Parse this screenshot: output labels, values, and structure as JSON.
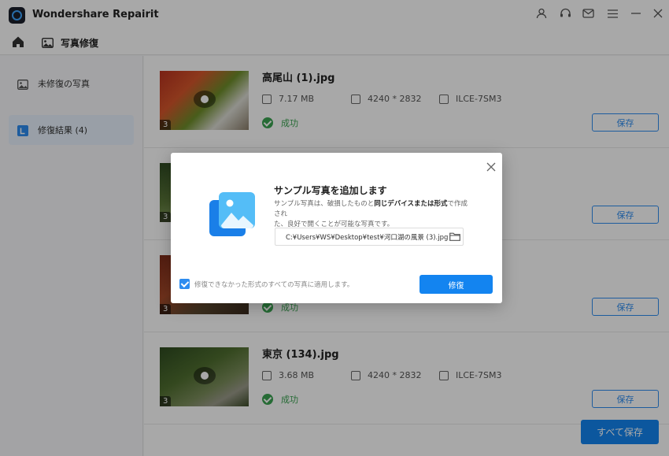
{
  "app": {
    "title": "Wondershare Repairit"
  },
  "navbar": {
    "title": "写真修復"
  },
  "sidebar": {
    "items": [
      {
        "label": "未修復の写真"
      },
      {
        "label": "修復結果 (4)"
      }
    ]
  },
  "cards": [
    {
      "filename": "高尾山 (1).jpg",
      "size": "7.17  MB",
      "resolution": "4240 * 2832",
      "camera": "ILCE-7SM3",
      "status": "成功",
      "badge": "3",
      "save_label": "保存"
    },
    {
      "filename": "",
      "size": "",
      "resolution": "",
      "camera": "",
      "status": "",
      "badge": "3",
      "save_label": "保存"
    },
    {
      "filename": "",
      "size": "",
      "resolution": "",
      "camera": "",
      "status": "成功",
      "badge": "3",
      "save_label": "保存"
    },
    {
      "filename": "東京 (134).jpg",
      "size": "3.68  MB",
      "resolution": "4240 * 2832",
      "camera": "ILCE-7SM3",
      "status": "成功",
      "badge": "3",
      "save_label": "保存"
    }
  ],
  "save_all_label": "すべて保存",
  "modal": {
    "title": "サンプル写真を追加します",
    "desc_1": "サンプル写真は、破損したものと",
    "desc_bold": "同じデバイスまたは形式",
    "desc_2": "で作成され",
    "desc_3": "た、良好で開くことが可能な写真です。",
    "path": "C:¥Users¥WS¥Desktop¥test¥河口湖の風景 (3).jpg",
    "checkbox_label": "修復できなかった形式のすべての写真に適用します。",
    "checkbox_checked": true,
    "repair_label": "修復"
  },
  "colors": {
    "accent": "#1384f0",
    "success": "#3aa351",
    "overlay": "rgba(0,0,0,0.34)"
  }
}
